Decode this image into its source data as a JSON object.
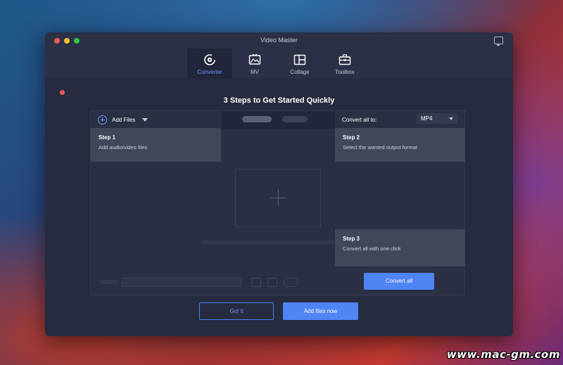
{
  "window": {
    "title": "Video Master"
  },
  "tabs": [
    {
      "label": "Converter",
      "icon": "converter-icon",
      "active": true
    },
    {
      "label": "MV",
      "icon": "mv-image-icon",
      "active": false
    },
    {
      "label": "Collage",
      "icon": "collage-icon",
      "active": false
    },
    {
      "label": "Toolbox",
      "icon": "toolbox-icon",
      "active": false
    }
  ],
  "guide": {
    "heading": "3 Steps to Get Started Quickly",
    "steps": [
      {
        "title": "Step 1",
        "desc": "Add audio/video files"
      },
      {
        "title": "Step 2",
        "desc": "Select the wanted output format"
      },
      {
        "title": "Step 3",
        "desc": "Convert all with one click"
      }
    ]
  },
  "toolbar": {
    "add_files_label": "Add Files",
    "convert_all_to_label": "Convert all to:",
    "format_value": "MP4",
    "convert_all_button": "Convert all"
  },
  "actions": {
    "got_it": "Got it",
    "add_files_now": "Add files now"
  },
  "watermark": "www.mac-gm.com",
  "colors": {
    "accent": "#4f84f5",
    "window_bg": "#2b3046",
    "close": "#ee5b57",
    "minimize": "#f3be35",
    "zoom": "#2fc74a"
  }
}
